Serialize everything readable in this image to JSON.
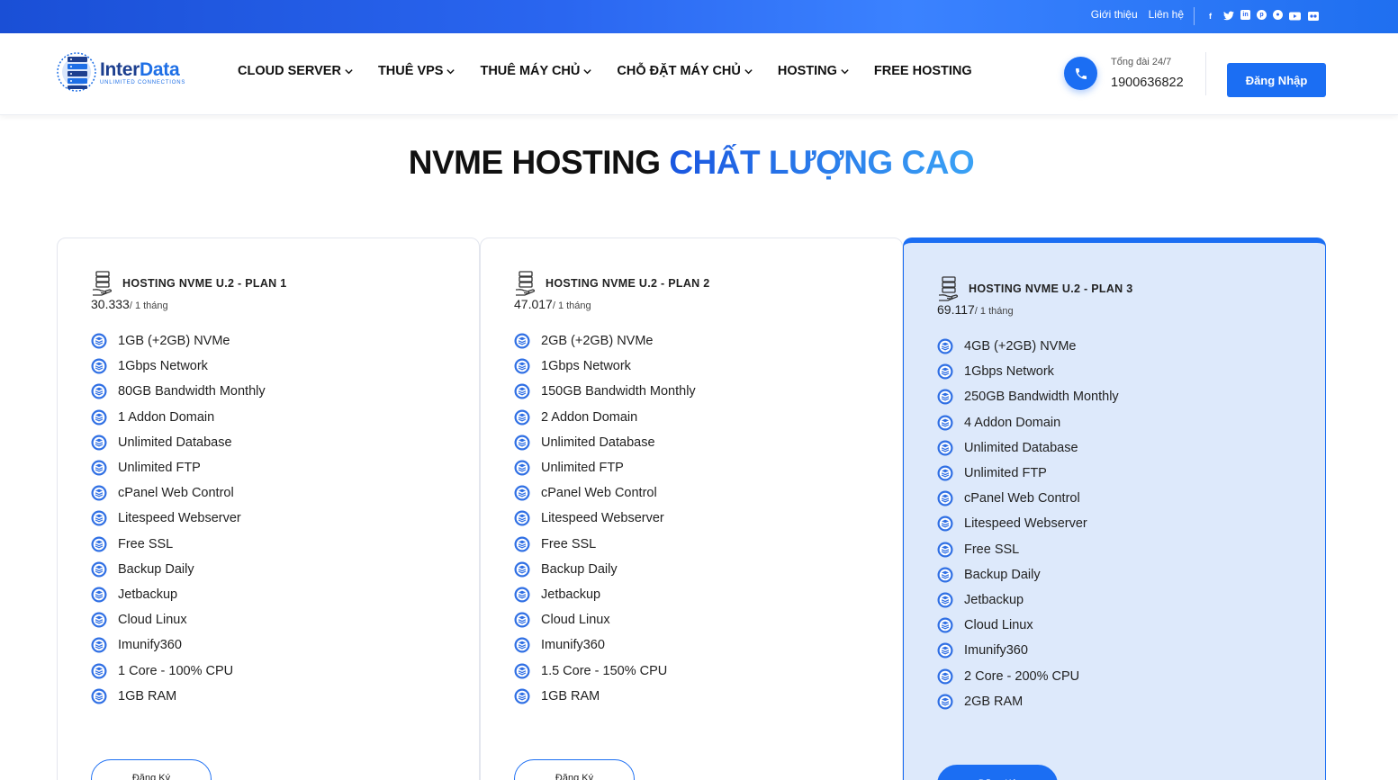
{
  "topbar": {
    "links": [
      "Giới thiệu",
      "Liên hệ"
    ],
    "social_icons": [
      "facebook-icon",
      "twitter-icon",
      "linkedin-icon",
      "pinterest-icon",
      "reddit-icon",
      "youtube-icon",
      "flickr-icon"
    ]
  },
  "header": {
    "logo": {
      "name_part1": "Inter",
      "name_part2": "Data",
      "tagline": "UNLIMITED CONNECTIONS"
    },
    "nav": [
      {
        "label": "CLOUD SERVER",
        "dropdown": true
      },
      {
        "label": "THUÊ VPS",
        "dropdown": true
      },
      {
        "label": "THUÊ MÁY CHỦ",
        "dropdown": true
      },
      {
        "label": "CHỖ ĐẶT MÁY CHỦ",
        "dropdown": true
      },
      {
        "label": "HOSTING",
        "dropdown": true
      },
      {
        "label": "FREE HOSTING",
        "dropdown": false
      }
    ],
    "hotline_label": "Tổng đài 24/7",
    "hotline_number": "1900636822",
    "login_label": "Đăng Nhập"
  },
  "section": {
    "title_main": "NVME HOSTING ",
    "title_accent": "CHẤT LƯỢNG CAO"
  },
  "colors": {
    "primary": "#1b6ef3",
    "highlight_card_bg": "#dde9fb",
    "text": "#222222"
  },
  "plans": [
    {
      "name": "HOSTING NVME U.2 - PLAN 1",
      "price": "30.333",
      "period": "/ 1 tháng",
      "features": [
        "1GB (+2GB) NVMe",
        "1Gbps Network",
        "80GB Bandwidth Monthly",
        "1 Addon Domain",
        "Unlimited Database",
        "Unlimited FTP",
        "cPanel Web Control",
        "Litespeed Webserver",
        "Free SSL",
        "Backup Daily",
        "Jetbackup",
        "Cloud Linux",
        "Imunify360",
        "1 Core - 100% CPU",
        "1GB RAM"
      ],
      "button": "Đăng Ký",
      "highlighted": false
    },
    {
      "name": "HOSTING NVME U.2 - PLAN 2",
      "price": "47.017",
      "period": "/ 1 tháng",
      "features": [
        "2GB (+2GB) NVMe",
        "1Gbps Network",
        "150GB Bandwidth Monthly",
        "2 Addon Domain",
        "Unlimited Database",
        "Unlimited FTP",
        "cPanel Web Control",
        "Litespeed Webserver",
        "Free SSL",
        "Backup Daily",
        "Jetbackup",
        "Cloud Linux",
        "Imunify360",
        "1.5 Core - 150% CPU",
        "1GB RAM"
      ],
      "button": "Đăng Ký",
      "highlighted": false
    },
    {
      "name": "HOSTING NVME U.2 - PLAN 3",
      "price": "69.117",
      "period": "/ 1 tháng",
      "features": [
        "4GB (+2GB) NVMe",
        "1Gbps Network",
        "250GB Bandwidth Monthly",
        "4 Addon Domain",
        "Unlimited Database",
        "Unlimited FTP",
        "cPanel Web Control",
        "Litespeed Webserver",
        "Free SSL",
        "Backup Daily",
        "Jetbackup",
        "Cloud Linux",
        "Imunify360",
        "2 Core - 200% CPU",
        "2GB RAM"
      ],
      "button": "Đăng Ký",
      "highlighted": true
    }
  ]
}
